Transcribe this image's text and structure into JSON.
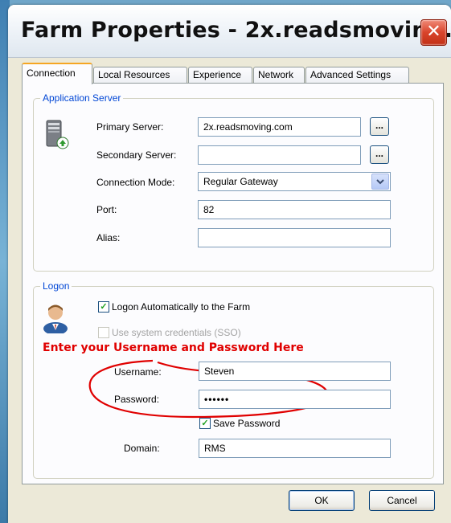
{
  "window": {
    "title": "Farm Properties - 2x.readsmovin...",
    "close_glyph": "✕"
  },
  "tabs": [
    {
      "label": "Connection",
      "active": true
    },
    {
      "label": "Local Resources",
      "active": false
    },
    {
      "label": "Experience",
      "active": false
    },
    {
      "label": "Network",
      "active": false
    },
    {
      "label": "Advanced Settings",
      "active": false
    }
  ],
  "application_server": {
    "legend": "Application Server",
    "icon": "server-icon",
    "primary_server_label": "Primary Server:",
    "primary_server_value": "2x.readsmoving.com",
    "secondary_server_label": "Secondary Server:",
    "secondary_server_value": "",
    "connection_mode_label": "Connection Mode:",
    "connection_mode_value": "Regular Gateway",
    "port_label": "Port:",
    "port_value": "82",
    "alias_label": "Alias:",
    "alias_value": "",
    "browse_label": "..."
  },
  "logon": {
    "legend": "Logon",
    "icon": "user-icon",
    "logon_auto_label": "Logon Automatically to the Farm",
    "logon_auto_checked": true,
    "sso_label": "Use system credentials (SSO)",
    "sso_checked": false,
    "annotation": "Enter your Username and Password Here",
    "username_label": "Username:",
    "username_value": "Steven",
    "password_label": "Password:",
    "password_value": "••••••",
    "save_password_label": "Save Password",
    "save_password_checked": true,
    "domain_label": "Domain:",
    "domain_value": "RMS"
  },
  "buttons": {
    "ok": "OK",
    "cancel": "Cancel"
  },
  "colors": {
    "annotation_red": "#e00000",
    "group_label_blue": "#0046d5",
    "active_tab_accent": "#f5a623"
  }
}
